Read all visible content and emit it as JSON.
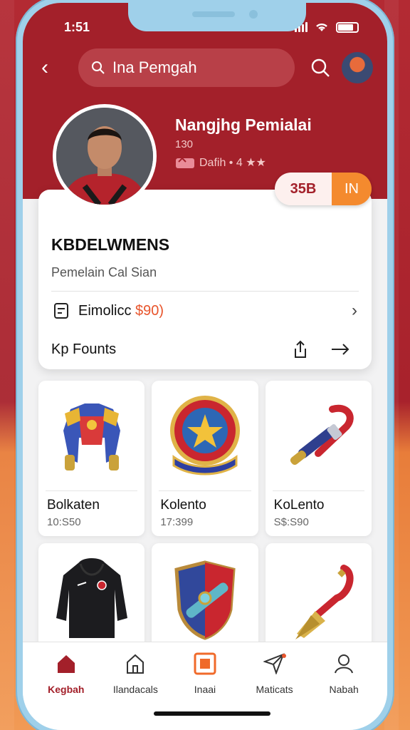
{
  "status": {
    "time": "1:51"
  },
  "search": {
    "placeholder": "Ina Pemgah"
  },
  "profile": {
    "name": "Nangjhg Pemialai",
    "subtitle": "130",
    "rating_text": "Dafih • 4 ★★"
  },
  "pill": {
    "value": "35B",
    "action": "IN"
  },
  "card": {
    "title": "KBDELWMENS",
    "subtitle": "Pemelain Cal Sian",
    "row1_label": "Eimolicc",
    "row1_price": "$90)",
    "row2_label": "Kp Founts"
  },
  "products": [
    {
      "name": "Bolkaten",
      "price": "10:S50"
    },
    {
      "name": "Kolento",
      "price": "17:399"
    },
    {
      "name": "KoLento",
      "price": "S$:S90"
    },
    {
      "name": "",
      "price": ""
    },
    {
      "name": "",
      "price": ""
    },
    {
      "name": "",
      "price": ""
    }
  ],
  "nav": [
    {
      "label": "Kegbah",
      "active": true
    },
    {
      "label": "Ilandacals"
    },
    {
      "label": "Inaai"
    },
    {
      "label": "Maticats"
    },
    {
      "label": "Nabah"
    }
  ],
  "colors": {
    "brand": "#a3202a",
    "accent": "#f48a2e",
    "frame": "#9fd0ea"
  }
}
